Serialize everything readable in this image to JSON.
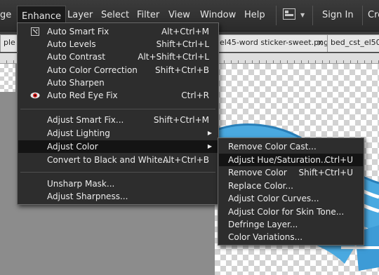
{
  "menubar": {
    "items": [
      "ge",
      "Enhance",
      "Layer",
      "Select",
      "Filter",
      "View",
      "Window",
      "Help"
    ],
    "sign_in": "Sign In",
    "create": "Cre"
  },
  "tabs": [
    {
      "label": "ple"
    },
    {
      "label": "el45-word sticker-sweet.png",
      "close": "×"
    },
    {
      "label": "bed_cst_el50-"
    }
  ],
  "enhance_menu": {
    "items": [
      {
        "label": "Auto Smart Fix",
        "shortcut": "Alt+Ctrl+M",
        "icon": "smart-fix-icon"
      },
      {
        "label": "Auto Levels",
        "shortcut": "Shift+Ctrl+L"
      },
      {
        "label": "Auto Contrast",
        "shortcut": "Alt+Shift+Ctrl+L"
      },
      {
        "label": "Auto Color Correction",
        "shortcut": "Shift+Ctrl+B"
      },
      {
        "label": "Auto Sharpen",
        "shortcut": ""
      },
      {
        "label": "Auto Red Eye Fix",
        "shortcut": "Ctrl+R",
        "icon": "red-eye-icon"
      },
      {
        "label": "Adjust Smart Fix...",
        "shortcut": "Shift+Ctrl+M"
      },
      {
        "label": "Adjust Lighting",
        "shortcut": "",
        "submenu": true
      },
      {
        "label": "Adjust Color",
        "shortcut": "",
        "submenu": true,
        "highlighted": true
      },
      {
        "label": "Convert to Black and White...",
        "shortcut": "Alt+Ctrl+B"
      },
      {
        "label": "Unsharp Mask...",
        "shortcut": ""
      },
      {
        "label": "Adjust Sharpness...",
        "shortcut": ""
      }
    ]
  },
  "adjust_color_submenu": {
    "items": [
      {
        "label": "Remove Color Cast...",
        "shortcut": ""
      },
      {
        "label": "Adjust Hue/Saturation...",
        "shortcut": "Ctrl+U",
        "highlighted": true
      },
      {
        "label": "Remove Color",
        "shortcut": "Shift+Ctrl+U"
      },
      {
        "label": "Replace Color...",
        "shortcut": ""
      },
      {
        "label": "Adjust Color Curves...",
        "shortcut": ""
      },
      {
        "label": "Adjust Color for Skin Tone...",
        "shortcut": ""
      },
      {
        "label": "Defringe Layer...",
        "shortcut": ""
      },
      {
        "label": "Color Variations...",
        "shortcut": ""
      }
    ]
  },
  "colors": {
    "menu_bg": "#2d2d2d",
    "highlight": "#141414",
    "artwork_blue": "#4aa9e0"
  }
}
